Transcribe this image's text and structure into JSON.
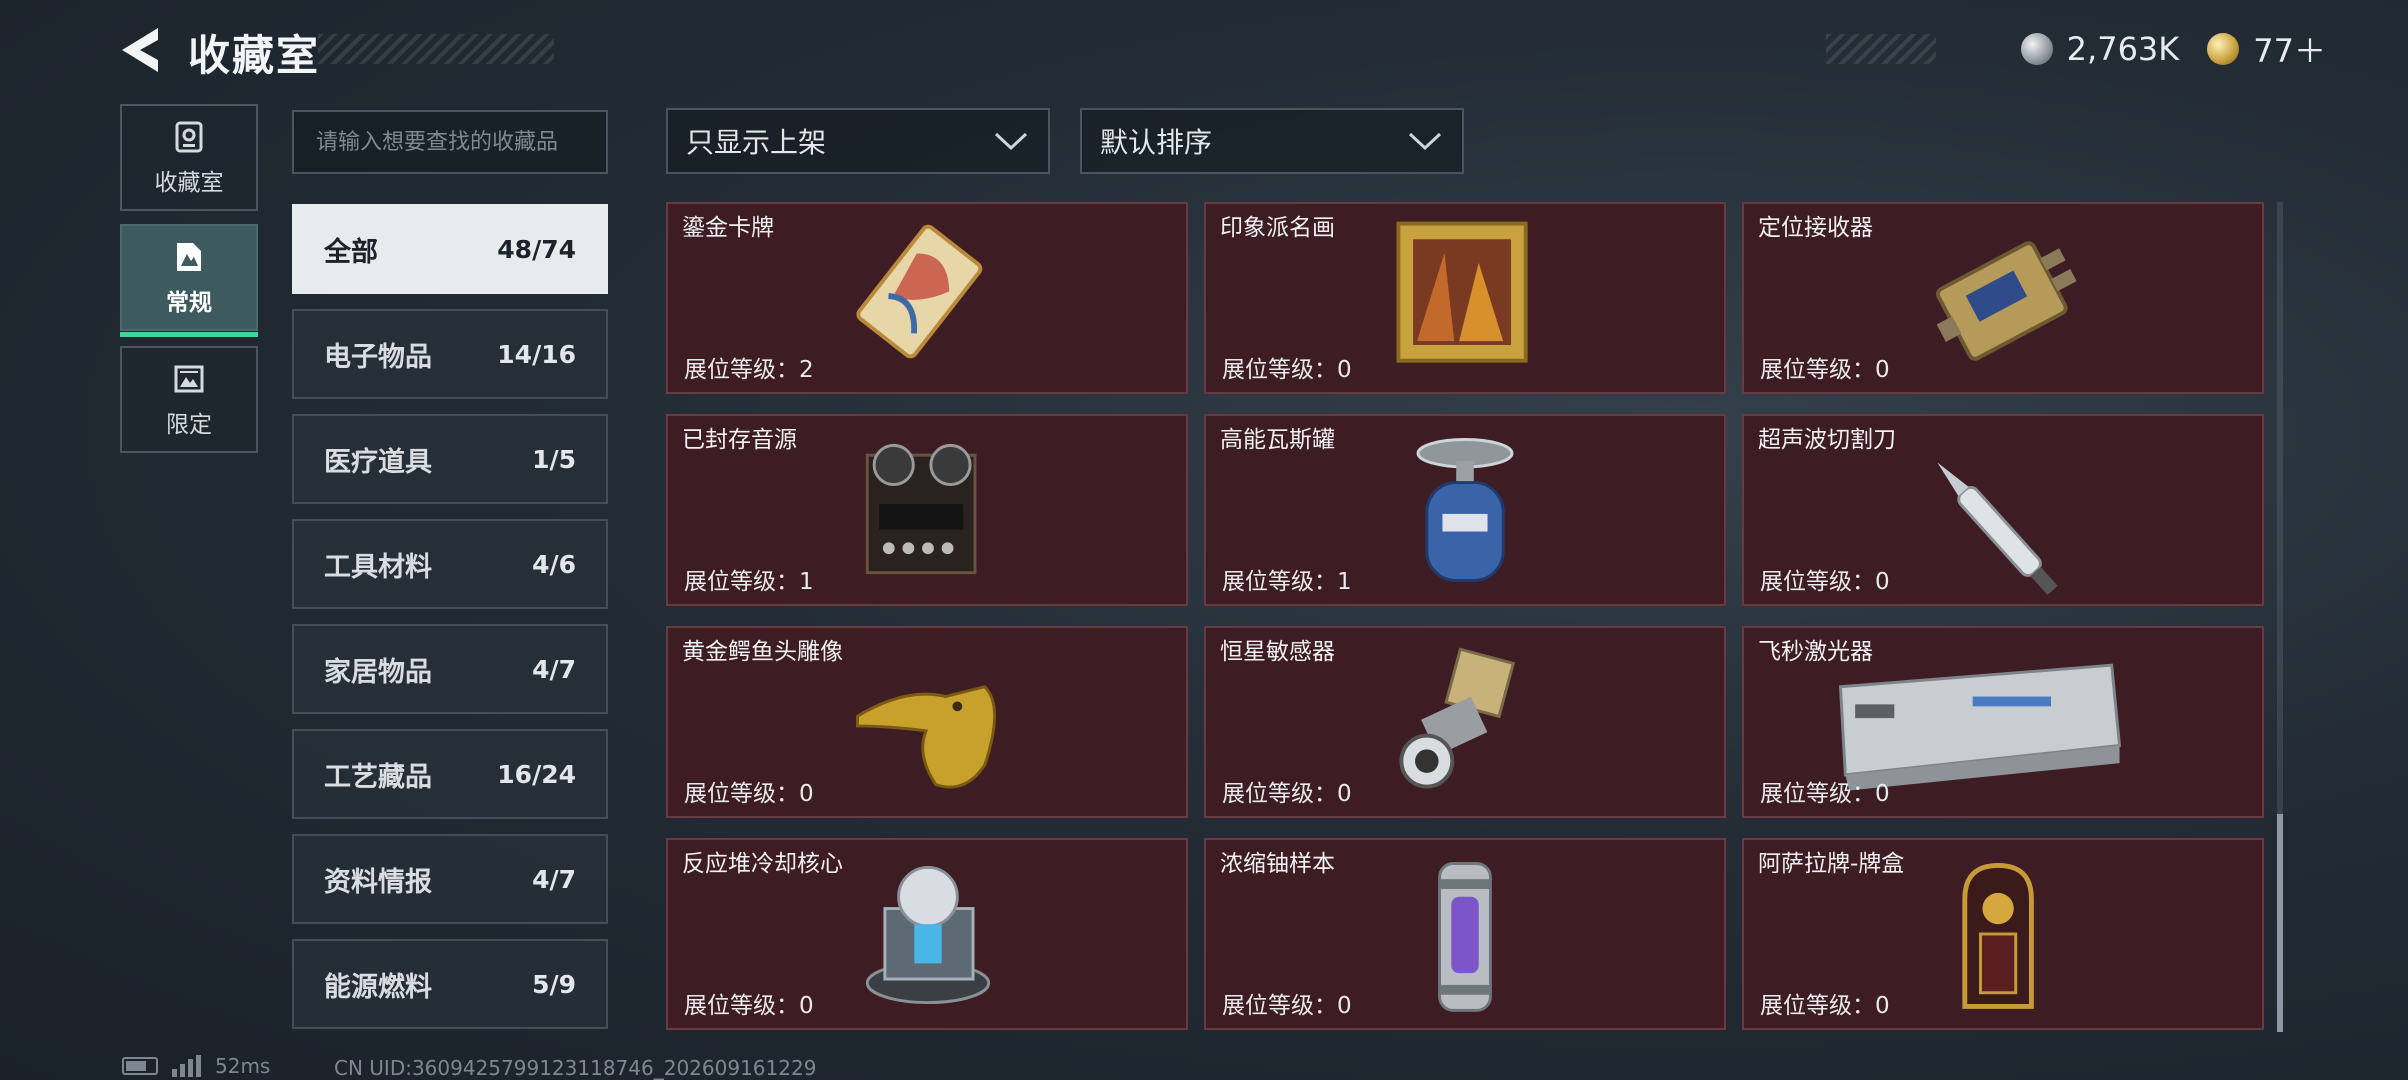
{
  "header": {
    "title": "收藏室",
    "currencies": [
      {
        "icon": "silver-coin-icon",
        "value": "2,763K"
      },
      {
        "icon": "gold-coin-icon",
        "value": "77＋"
      }
    ]
  },
  "side_nav": [
    {
      "label": "收藏室",
      "icon": "vault-icon",
      "active": false
    },
    {
      "label": "常规",
      "icon": "regular-collection-icon",
      "active": true
    },
    {
      "label": "限定",
      "icon": "limited-collection-icon",
      "active": false
    }
  ],
  "search": {
    "placeholder": "请输入想要查找的收藏品",
    "value": ""
  },
  "categories": [
    {
      "name": "全部",
      "count": "48/74",
      "active": true
    },
    {
      "name": "电子物品",
      "count": "14/16"
    },
    {
      "name": "医疗道具",
      "count": "1/5"
    },
    {
      "name": "工具材料",
      "count": "4/6"
    },
    {
      "name": "家居物品",
      "count": "4/7"
    },
    {
      "name": "工艺藏品",
      "count": "16/24"
    },
    {
      "name": "资料情报",
      "count": "4/7"
    },
    {
      "name": "能源燃料",
      "count": "5/9"
    }
  ],
  "filters": {
    "shelf_filter": "只显示上架",
    "sort": "默认排序"
  },
  "items": [
    {
      "name": "鎏金卡牌",
      "level": "展位等级：2",
      "icon": "gilded-card-icon"
    },
    {
      "name": "印象派名画",
      "level": "展位等级：0",
      "icon": "impressionist-painting-icon"
    },
    {
      "name": "定位接收器",
      "level": "展位等级：0",
      "icon": "locator-receiver-icon"
    },
    {
      "name": "已封存音源",
      "level": "展位等级：1",
      "icon": "tape-recorder-icon"
    },
    {
      "name": "高能瓦斯罐",
      "level": "展位等级：1",
      "icon": "gas-canister-icon"
    },
    {
      "name": "超声波切割刀",
      "level": "展位等级：0",
      "icon": "ultrasonic-knife-icon"
    },
    {
      "name": "黄金鳄鱼头雕像",
      "level": "展位等级：0",
      "icon": "gold-crocodile-statue-icon"
    },
    {
      "name": "恒星敏感器",
      "level": "展位等级：0",
      "icon": "star-sensor-icon"
    },
    {
      "name": "飞秒激光器",
      "level": "展位等级：0",
      "icon": "femtosecond-laser-icon"
    },
    {
      "name": "反应堆冷却核心",
      "level": "展位等级：0",
      "icon": "reactor-core-icon"
    },
    {
      "name": "浓缩铀样本",
      "level": "展位等级：0",
      "icon": "uranium-sample-icon"
    },
    {
      "name": "阿萨拉牌-牌盒",
      "level": "展位等级：0",
      "icon": "card-box-icon"
    }
  ],
  "status": {
    "ping": "52ms",
    "uid": "CN UID:3609425799123118746_202609161229"
  },
  "colors": {
    "card_bg": "#3e1c23",
    "card_border": "#6a3a43",
    "active_nav": "#3d5b5e",
    "active_indicator": "#3ed79a"
  }
}
